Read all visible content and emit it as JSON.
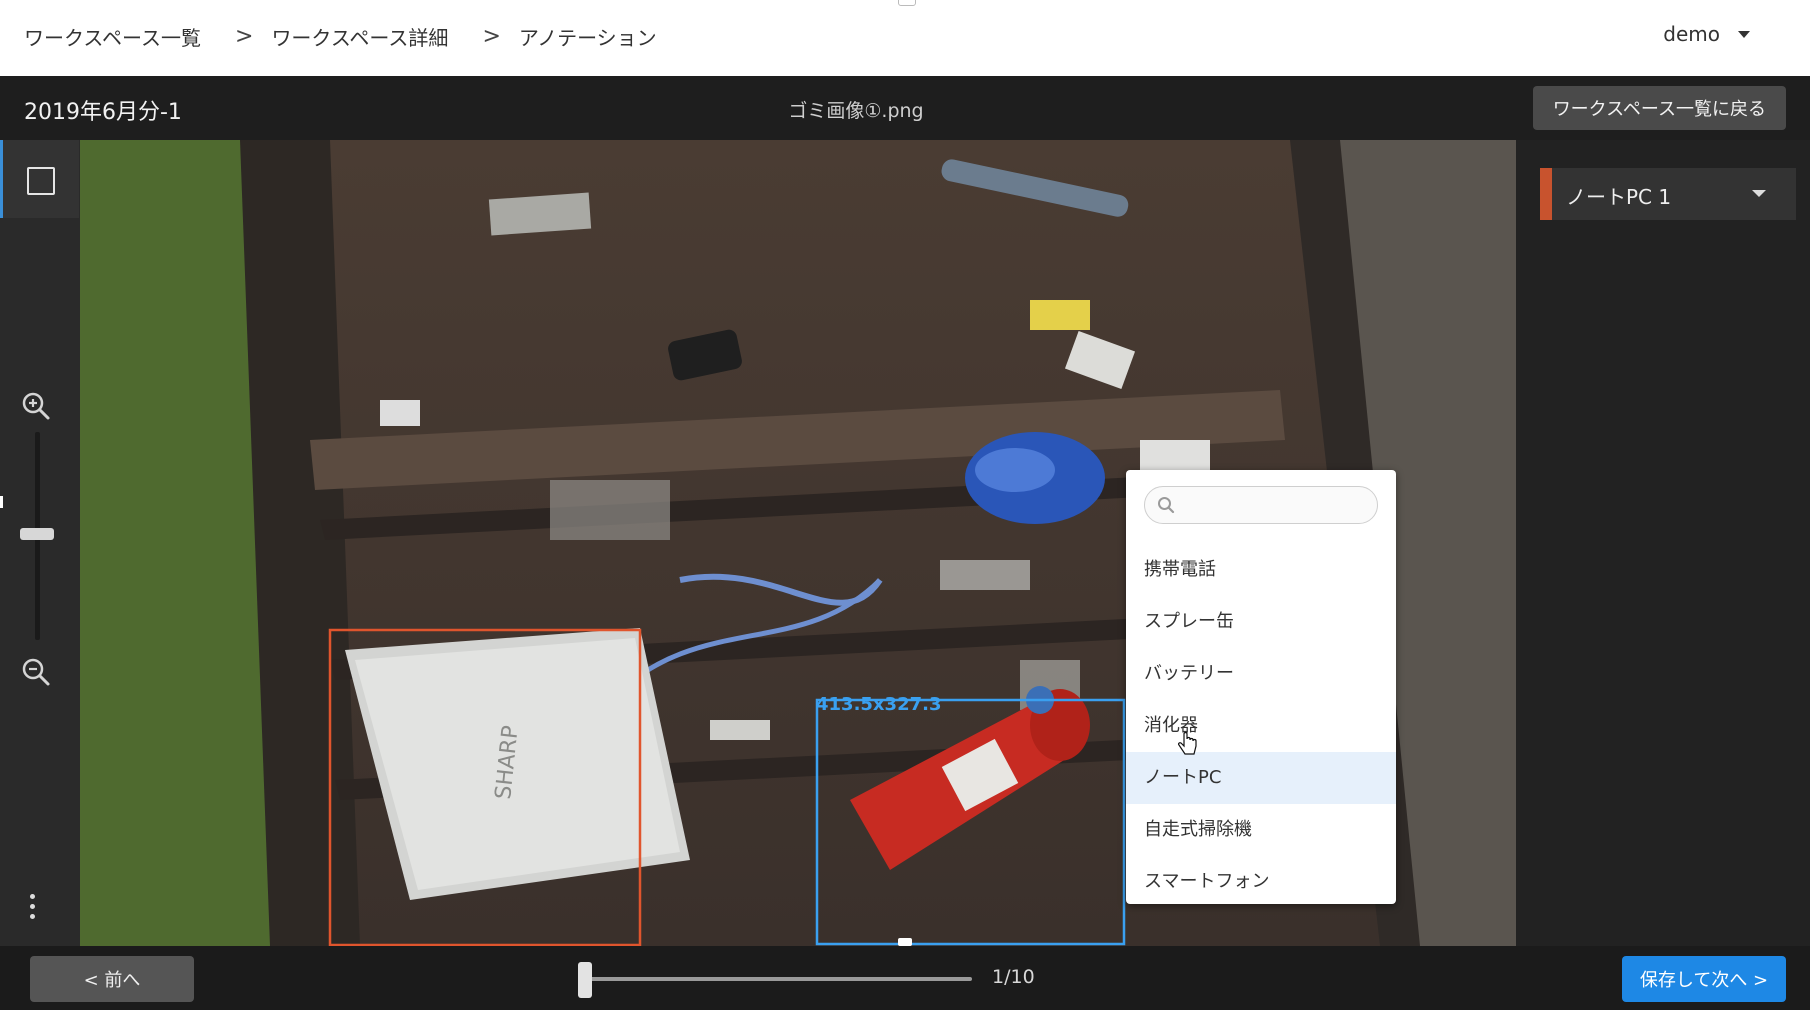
{
  "breadcrumb": {
    "items": [
      "ワークスペース一覧",
      "ワークスペース詳細",
      "アノテーション"
    ],
    "separator": ">"
  },
  "user": {
    "name": "demo"
  },
  "header": {
    "workspace_name": "2019年6月分-1",
    "file_name": "ゴミ画像①.png",
    "back_button": "ワークスペース一覧に戻る"
  },
  "toolbar": {
    "tools": [
      "rectangle-tool",
      "zoom-in",
      "zoom-slider",
      "zoom-out",
      "more-menu"
    ]
  },
  "canvas": {
    "annotations": [
      {
        "label": "ノートPC",
        "color": "#e0552d"
      },
      {
        "label": "消化器",
        "color": "#3aa0f0",
        "size_text": "413.5x327.3"
      }
    ]
  },
  "right_panel": {
    "selected_label": "ノートPC 1",
    "label_color": "#c8532e"
  },
  "dropdown": {
    "search_placeholder": "",
    "options": [
      "携帯電話",
      "スプレー缶",
      "バッテリー",
      "消化器",
      "ノートPC",
      "自走式掃除機",
      "スマートフォン"
    ],
    "active_option": "ノートPC"
  },
  "footer": {
    "prev_button": "< 前へ",
    "page_counter": "1/10",
    "save_next_button": "保存して次へ >"
  },
  "colors": {
    "accent": "#1e88e5",
    "header_bg": "#1e1e1e",
    "selection_blue": "#3aa0f0",
    "selection_orange": "#e0552d"
  }
}
